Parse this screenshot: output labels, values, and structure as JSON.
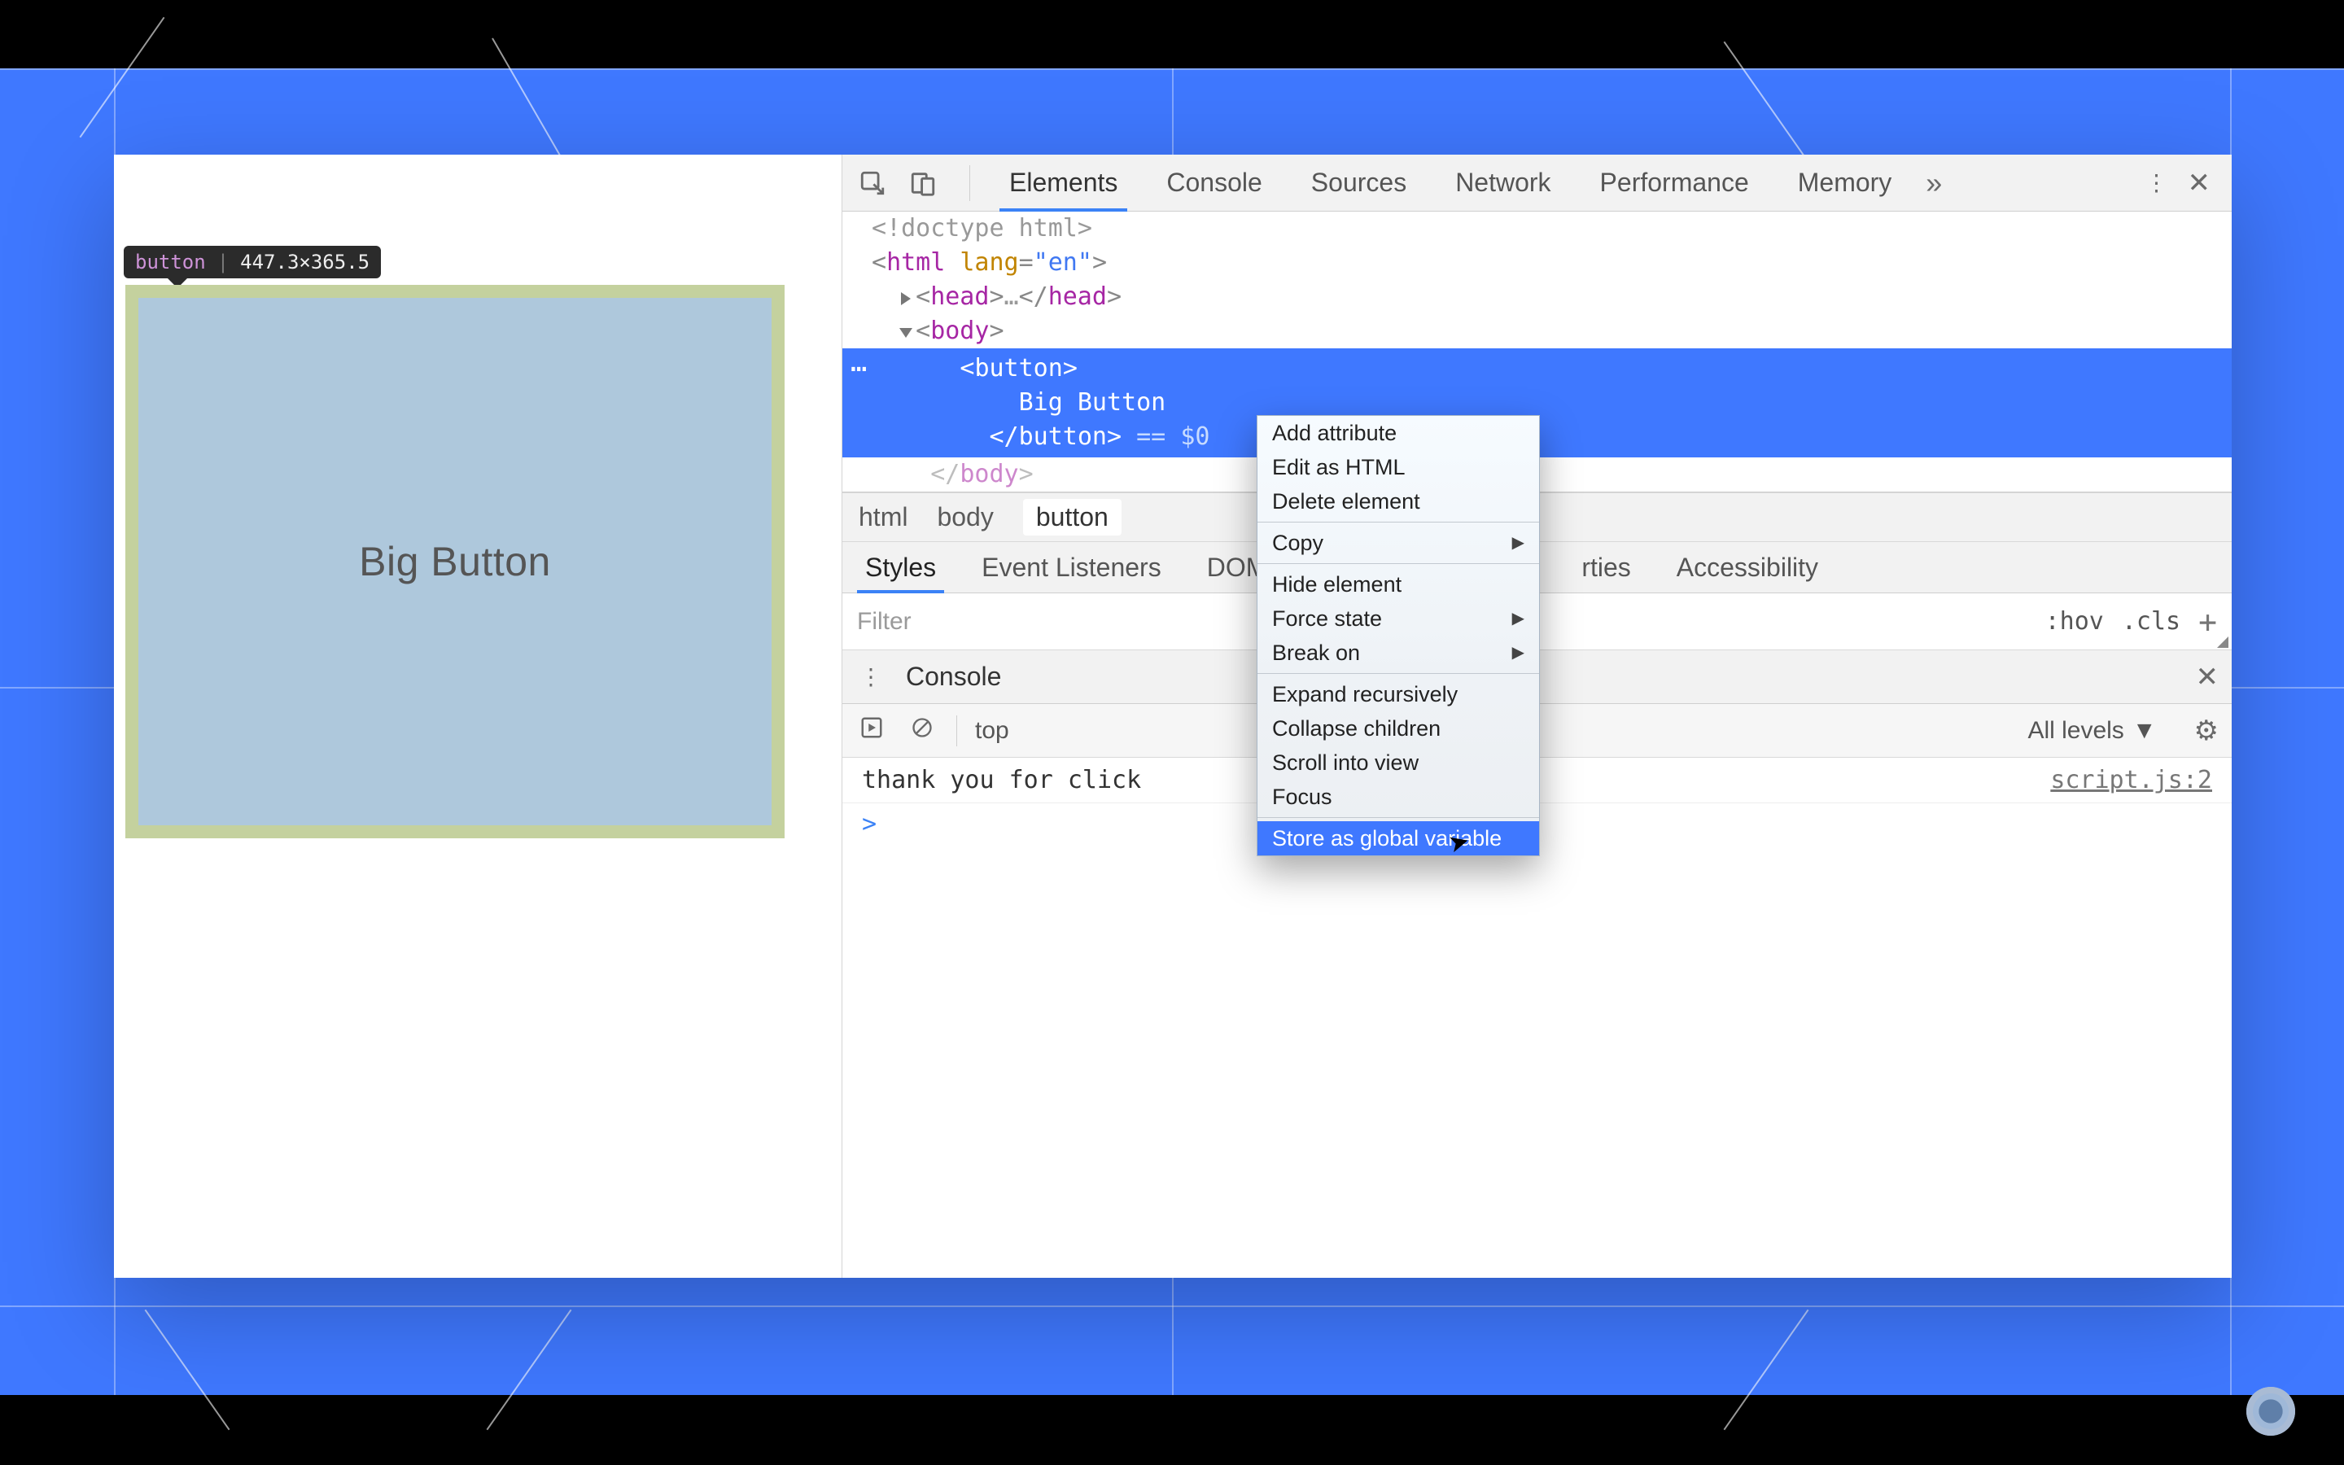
{
  "tooltip": {
    "tag": "button",
    "dims": "447.3×365.5"
  },
  "page": {
    "button_label": "Big Button"
  },
  "toolbar": {
    "tabs": [
      "Elements",
      "Console",
      "Sources",
      "Network",
      "Performance",
      "Memory"
    ],
    "active_tab_index": 0
  },
  "dom": {
    "l0": "<!doctype html>",
    "l1_open": "<",
    "l1_tag": "html",
    "l1_attr": " lang",
    "l1_eq": "=",
    "l1_val": "\"en\"",
    "l1_close": ">",
    "l2_open": "<",
    "l2_tag": "head",
    "l2_close": ">",
    "l2_dots": "…",
    "l2_endopen": "</",
    "l2_endtag": "head",
    "l2_endclose": ">",
    "l3_open": "<",
    "l3_tag": "body",
    "l3_close": ">",
    "sel_open": "<",
    "sel_tag": "button",
    "sel_close": ">",
    "sel_text": "Big Button",
    "sel_endopen": "</",
    "sel_endtag": "button",
    "sel_endclose": ">",
    "sel_eq": " == ",
    "sel_zero": "$0",
    "l5_open": "</",
    "l5_tag": "body",
    "l5_close": ">"
  },
  "breadcrumbs": {
    "a": "html",
    "b": "body",
    "c": "button"
  },
  "subtabs": {
    "styles": "Styles",
    "listeners": "Event Listeners",
    "dom_bp": "DOM Breakpoints",
    "properties_suffix": "rties",
    "accessibility": "Accessibility"
  },
  "filter": {
    "placeholder": "Filter",
    "hov": ":hov",
    "cls": ".cls"
  },
  "console": {
    "title": "Console",
    "context": "top",
    "levels": "All levels",
    "log_text": "thank you for click",
    "log_src": "script.js:2",
    "prompt": ">"
  },
  "context_menu": {
    "items": [
      {
        "label": "Add attribute",
        "sub": false
      },
      {
        "label": "Edit as HTML",
        "sub": false
      },
      {
        "label": "Delete element",
        "sub": false
      },
      {
        "sep": true
      },
      {
        "label": "Copy",
        "sub": true
      },
      {
        "sep": true
      },
      {
        "label": "Hide element",
        "sub": false
      },
      {
        "label": "Force state",
        "sub": true
      },
      {
        "label": "Break on",
        "sub": true
      },
      {
        "sep": true
      },
      {
        "label": "Expand recursively",
        "sub": false
      },
      {
        "label": "Collapse children",
        "sub": false
      },
      {
        "label": "Scroll into view",
        "sub": false
      },
      {
        "label": "Focus",
        "sub": false
      },
      {
        "sep": true
      },
      {
        "label": "Store as global variable",
        "sub": false,
        "highlight": true
      }
    ]
  }
}
